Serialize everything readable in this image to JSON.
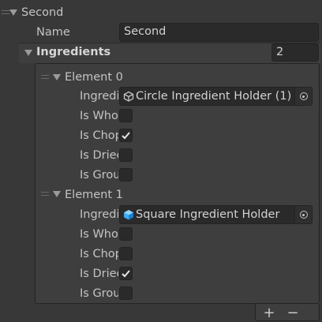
{
  "root": {
    "label": "Second"
  },
  "name_field": {
    "label": "Name",
    "value": "Second"
  },
  "ingredients": {
    "label": "Ingredients",
    "size": "2",
    "elements": [
      {
        "label": "Element 0",
        "ingredient_label": "Ingredi",
        "ingredient_value": "Circle Ingredient Holder (1)",
        "ingredient_icon": "prefab-outline-icon",
        "flags": [
          {
            "label": "Is Who",
            "checked": false
          },
          {
            "label": "Is Chop",
            "checked": true
          },
          {
            "label": "Is Driec",
            "checked": false
          },
          {
            "label": "Is Grou",
            "checked": false
          }
        ]
      },
      {
        "label": "Element 1",
        "ingredient_label": "Ingredi",
        "ingredient_value": "Square Ingredient Holder",
        "ingredient_icon": "prefab-blue-icon",
        "flags": [
          {
            "label": "Is Who",
            "checked": false
          },
          {
            "label": "Is Chop",
            "checked": false
          },
          {
            "label": "Is Driec",
            "checked": true
          },
          {
            "label": "Is Grou",
            "checked": false
          }
        ]
      }
    ],
    "add_label": "+",
    "remove_label": "−"
  },
  "colors": {
    "background": "#383838",
    "field": "#2a2a2a",
    "text": "#c4c4c4",
    "prefab_blue": "#3fa9f5"
  }
}
